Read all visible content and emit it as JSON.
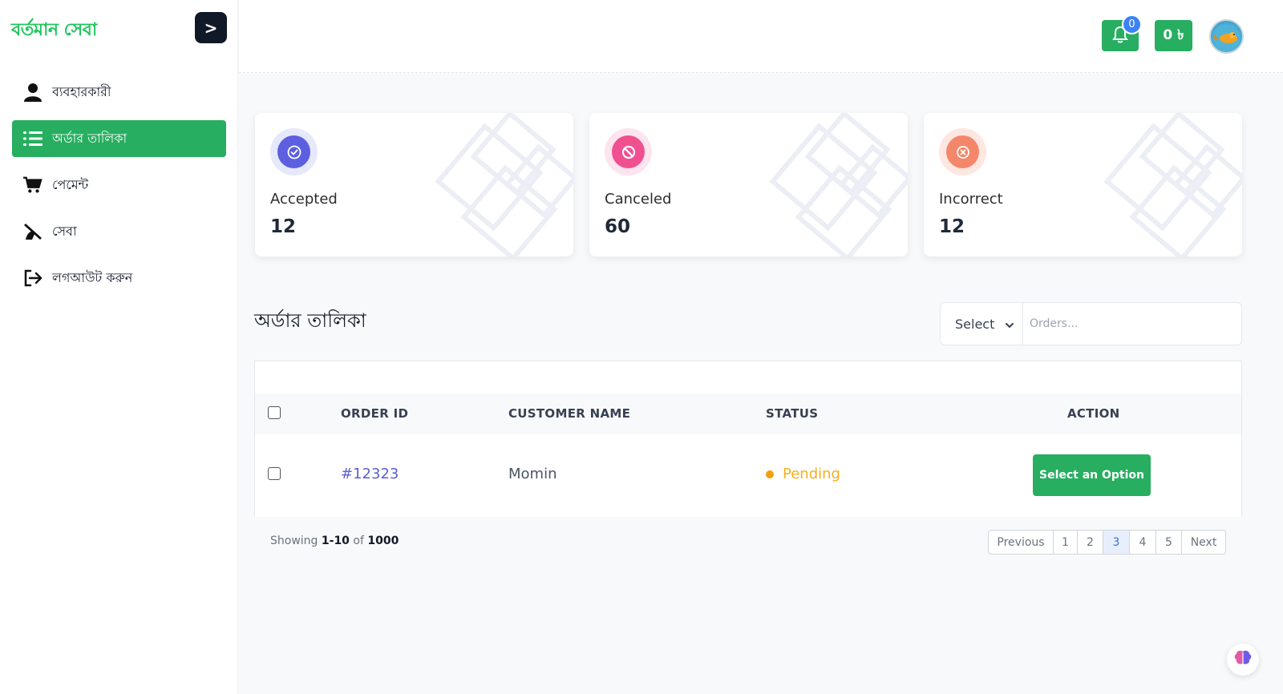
{
  "brand": {
    "title": "বর্তমান সেবা",
    "toggle_label": ">"
  },
  "sidebar": {
    "items": [
      {
        "label": "ব্যবহারকারী",
        "icon": "user-icon",
        "active": false
      },
      {
        "label": "অর্ডার তালিকা",
        "icon": "list-icon",
        "active": true
      },
      {
        "label": "পেমেন্ট",
        "icon": "cart-icon",
        "active": false
      },
      {
        "label": "সেবা",
        "icon": "service-icon",
        "active": false
      },
      {
        "label": "লগআউট করুন",
        "icon": "logout-icon",
        "active": false
      }
    ]
  },
  "header": {
    "notification_count": "0",
    "balance": "0 ৳",
    "avatar": "avatar-image"
  },
  "stats": [
    {
      "label": "Accepted",
      "value": "12",
      "icon": "check-circle-icon",
      "color": "#5b5fe0",
      "ring": "#e6e8fb"
    },
    {
      "label": "Canceled",
      "value": "60",
      "icon": "ban-icon",
      "color": "#f0508f",
      "ring": "#fde4ee"
    },
    {
      "label": "Incorrect",
      "value": "12",
      "icon": "x-circle-icon",
      "color": "#f4866a",
      "ring": "#fde7e0"
    }
  ],
  "orders": {
    "title": "অর্ডার তালিকা",
    "filter_select": "Select",
    "search_placeholder": "Orders...",
    "columns": {
      "id": "ORDER ID",
      "customer": "CUSTOMER NAME",
      "status": "STATUS",
      "action": "ACTION"
    },
    "rows": [
      {
        "id": "#12323",
        "customer": "Momin",
        "status": "Pending",
        "action": "Select an Option"
      }
    ]
  },
  "pagination": {
    "showing_prefix": "Showing",
    "range": "1-10",
    "of": "of",
    "total": "1000",
    "previous": "Previous",
    "pages": [
      "1",
      "2",
      "3",
      "4",
      "5"
    ],
    "active_page": "3",
    "next": "Next"
  },
  "colors": {
    "accent": "#27ae60",
    "brand": "#22c55e",
    "link": "#5b5fd6",
    "pending": "#f2b01e"
  }
}
